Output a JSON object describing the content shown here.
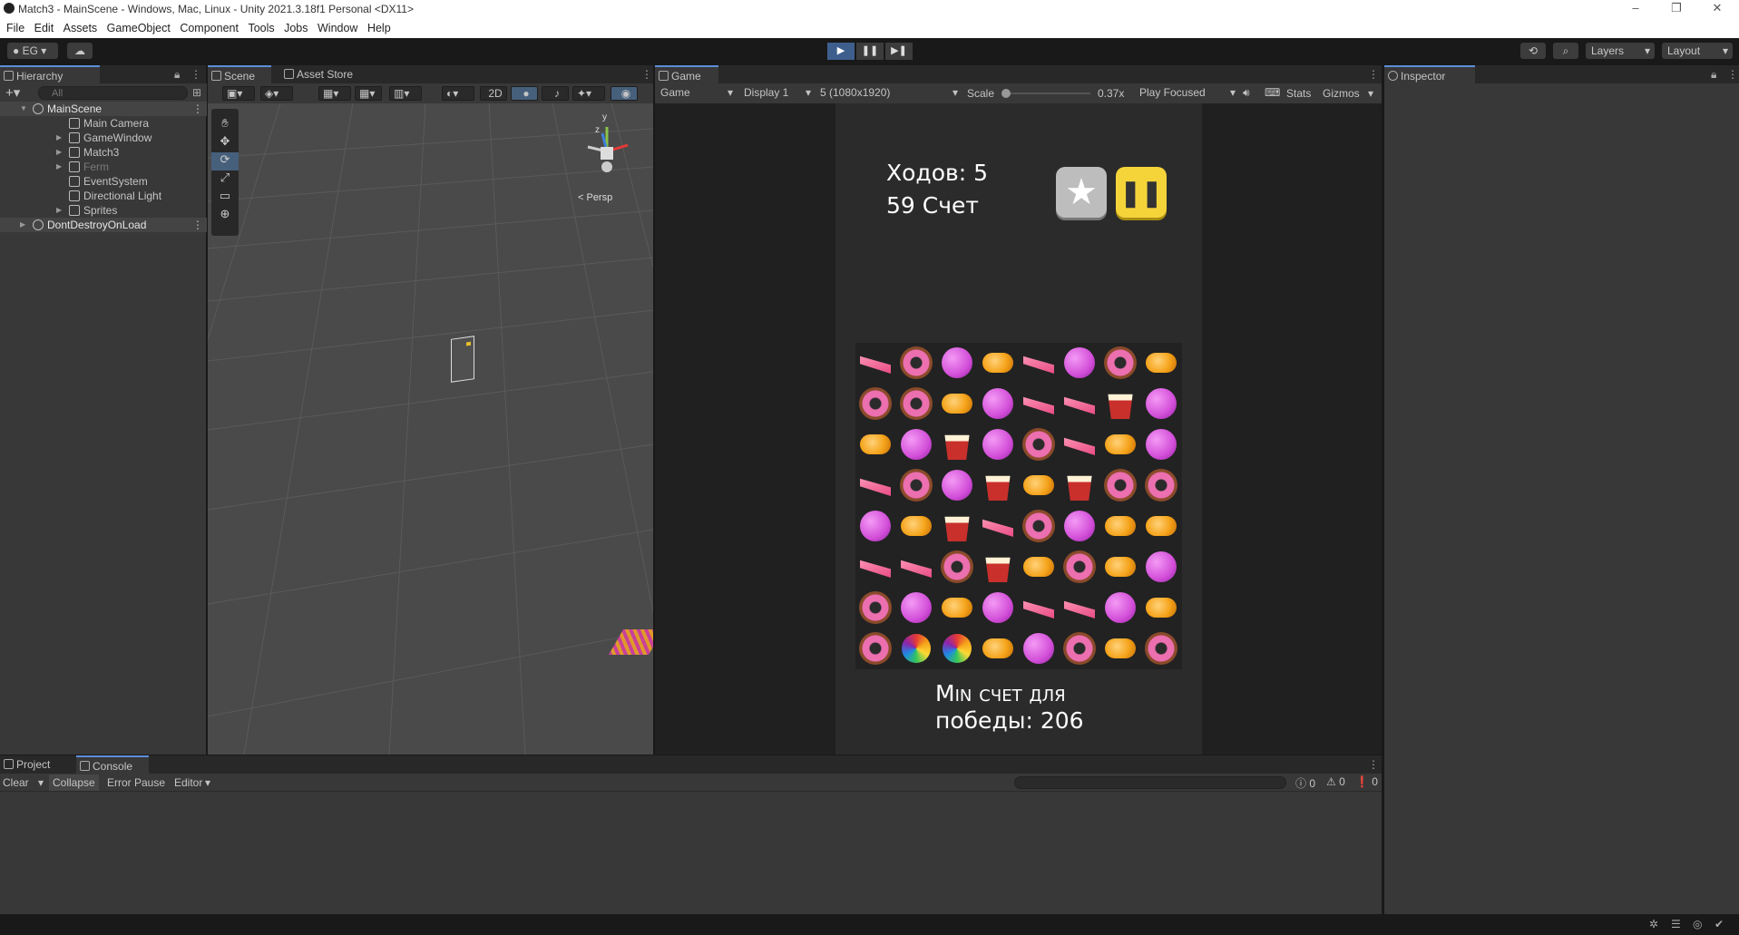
{
  "window": {
    "title": "Match3 - MainScene - Windows, Mac, Linux - Unity 2021.3.18f1 Personal <DX11>",
    "controls": [
      "–",
      "❐",
      "✕"
    ]
  },
  "menu": [
    "File",
    "Edit",
    "Assets",
    "GameObject",
    "Component",
    "Tools",
    "Jobs",
    "Window",
    "Help"
  ],
  "toolbar": {
    "account": "EG",
    "layers": "Layers",
    "layout": "Layout"
  },
  "hierarchy": {
    "tab": "Hierarchy",
    "search_placeholder": "All",
    "items": [
      {
        "label": "MainScene",
        "depth": 0,
        "scene": true
      },
      {
        "label": "Main Camera",
        "depth": 1
      },
      {
        "label": "GameWindow",
        "depth": 1
      },
      {
        "label": "Match3",
        "depth": 1
      },
      {
        "label": "Ferm",
        "depth": 1,
        "disabled": true
      },
      {
        "label": "EventSystem",
        "depth": 1
      },
      {
        "label": "Directional Light",
        "depth": 1
      },
      {
        "label": "Sprites",
        "depth": 1
      },
      {
        "label": "DontDestroyOnLoad",
        "depth": 0,
        "scene": true
      }
    ]
  },
  "scene": {
    "tabs": [
      "Scene",
      "Asset Store"
    ],
    "mode_2d": "2D",
    "persp": "< Persp",
    "gizmo_y": "y",
    "gizmo_z": "z"
  },
  "game": {
    "tab": "Game",
    "view": "Game",
    "display": "Display 1",
    "resolution": "5 (1080x1920)",
    "scale_label": "Scale",
    "scale_value": "0.37x",
    "play_mode": "Play Focused",
    "stats": "Stats",
    "gizmos": "Gizmos",
    "moves": "Ходов: 5",
    "score": "59 Счет",
    "goal_line1": "Min счет для",
    "goal_line2": "победы: 206",
    "board": [
      [
        "cake",
        "donut",
        "ball",
        "candy",
        "cake",
        "ball",
        "donut",
        "candy"
      ],
      [
        "donut",
        "donut",
        "candy",
        "ball",
        "cake",
        "cake",
        "cupcake",
        "ball"
      ],
      [
        "candy",
        "ball",
        "cupcake",
        "ball",
        "donut",
        "cake",
        "candy",
        "ball"
      ],
      [
        "cake",
        "donut",
        "ball",
        "cupcake",
        "candy",
        "cupcake",
        "donut",
        "donut"
      ],
      [
        "ball",
        "candy",
        "cupcake",
        "cake",
        "donut",
        "ball",
        "candy",
        "candy"
      ],
      [
        "cake",
        "cake",
        "donut",
        "cupcake",
        "candy",
        "donut",
        "candy",
        "ball"
      ],
      [
        "donut",
        "ball",
        "candy",
        "ball",
        "cake",
        "cake",
        "ball",
        "candy"
      ],
      [
        "donut",
        "bomb",
        "bomb",
        "candy",
        "ball",
        "donut",
        "candy",
        "donut"
      ]
    ],
    "colors": {
      "cake": "#e84c85",
      "donut": "#ec6fb0",
      "ball": "#d24ed8",
      "candy": "#f5a31a",
      "cupcake": "#c9302c",
      "bomb": "#34c759"
    }
  },
  "inspector": {
    "tab": "Inspector"
  },
  "console": {
    "tabs": [
      "Project",
      "Console"
    ],
    "clear": "Clear",
    "collapse": "Collapse",
    "error_pause": "Error Pause",
    "editor": "Editor",
    "counts": [
      "0",
      "0",
      "0"
    ]
  }
}
